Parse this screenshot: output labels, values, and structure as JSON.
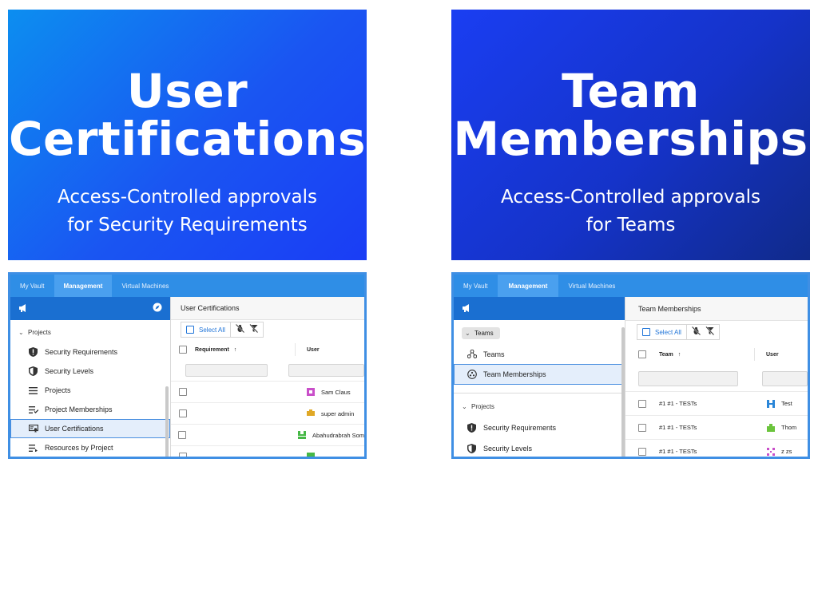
{
  "hero_left": {
    "title_line1": "User",
    "title_line2": "Certifications",
    "subtitle_line1": "Access-Controlled approvals",
    "subtitle_line2": "for Security Requirements",
    "gradient_start": "#0c8ef0",
    "gradient_end": "#1a3df5"
  },
  "hero_right": {
    "title_line1": "Team",
    "title_line2": "Memberships",
    "subtitle_line1": "Access-Controlled approvals",
    "subtitle_line2": "for Teams",
    "gradient_start": "#1a3ef2",
    "gradient_end": "#102a8a"
  },
  "app_left": {
    "tabs": [
      "My Vault",
      "Management",
      "Virtual Machines"
    ],
    "active_tab": "Management",
    "sidebar_group": "Projects",
    "sidebar_items": [
      {
        "label": "Security Requirements",
        "icon": "alert-shield-icon"
      },
      {
        "label": "Security Levels",
        "icon": "shield-icon"
      },
      {
        "label": "Projects",
        "icon": "list-icon"
      },
      {
        "label": "Project Memberships",
        "icon": "list-check-icon"
      },
      {
        "label": "User Certifications",
        "icon": "certificate-icon",
        "selected": true
      },
      {
        "label": "Resources by Project",
        "icon": "list-arrow-icon"
      }
    ],
    "page_title": "User Certifications",
    "select_all": "Select All",
    "col_a": "Requirement",
    "col_b": "User",
    "rows": [
      {
        "a": "",
        "user": "Sam Claus",
        "avatar_color": "#c94fc9"
      },
      {
        "a": "",
        "user": "super admin",
        "avatar_color": "#e0a826"
      },
      {
        "a": "",
        "user": "Abahudrabrah Som",
        "avatar_color": "#46b846"
      },
      {
        "a": "",
        "user": "",
        "avatar_color": "#46b846"
      }
    ]
  },
  "app_right": {
    "tabs": [
      "My Vault",
      "Management",
      "Virtual Machines"
    ],
    "active_tab": "Management",
    "group_teams": "Teams",
    "teams_items": [
      {
        "label": "Teams",
        "icon": "team-network-icon"
      },
      {
        "label": "Team Memberships",
        "icon": "team-circle-icon",
        "selected": true
      }
    ],
    "group_projects": "Projects",
    "projects_items": [
      {
        "label": "Security Requirements",
        "icon": "alert-shield-icon"
      },
      {
        "label": "Security Levels",
        "icon": "shield-icon"
      }
    ],
    "page_title": "Team Memberships",
    "select_all": "Select All",
    "col_a": "Team",
    "col_b": "User",
    "rows": [
      {
        "a": "#1 #1 - TESTs",
        "user": "Test",
        "avatar_color": "#2a86d8"
      },
      {
        "a": "#1 #1 - TESTs",
        "user": "Thom",
        "avatar_color": "#6bc43c"
      },
      {
        "a": "#1 #1 - TESTs",
        "user": "z zs",
        "avatar_color": "#c94fc9"
      }
    ]
  }
}
